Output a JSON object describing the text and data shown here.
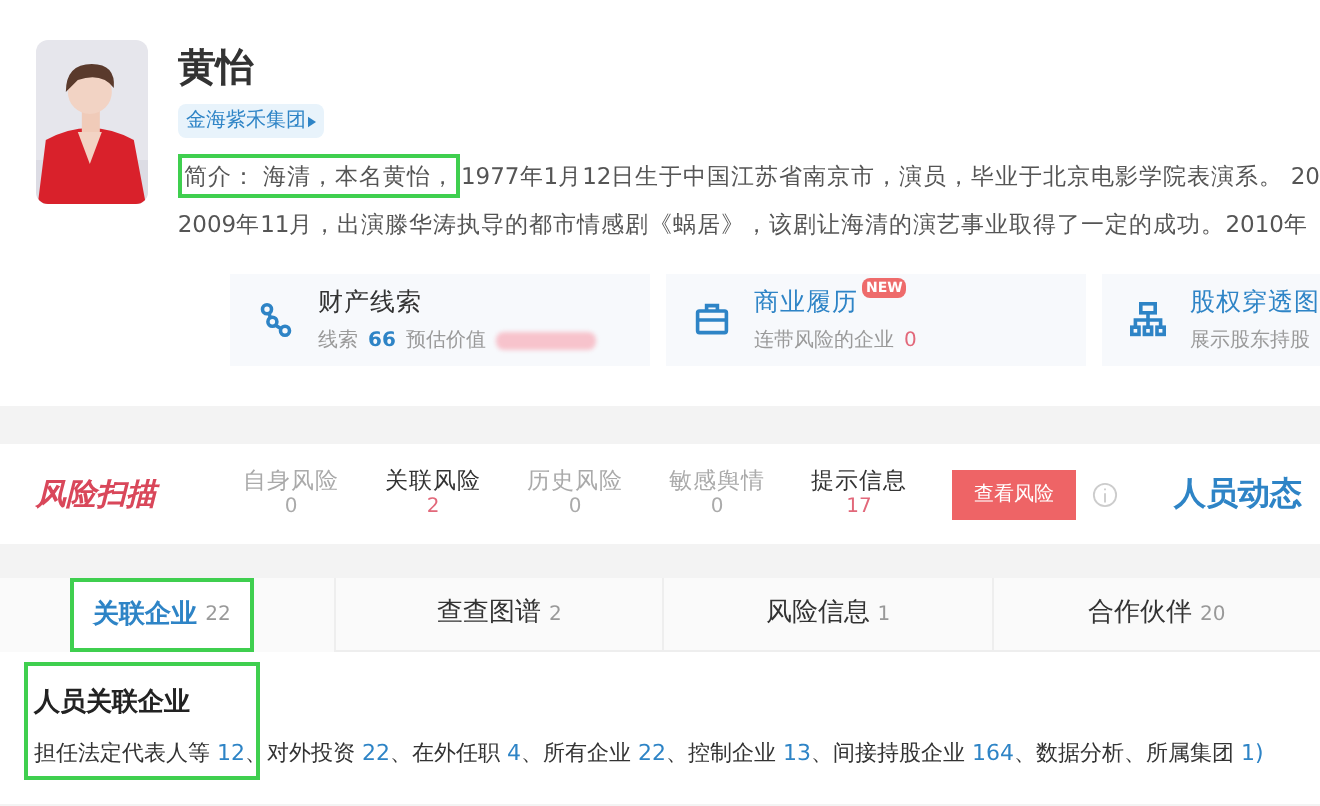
{
  "profile": {
    "kind": "picture",
    "name": "黄怡",
    "group_tag": "金海紫禾集团",
    "intro_highlight": "简介： 海清，本名黄怡，",
    "intro_lines": [
      "1977年1月12日生于中国江苏省南京市，演员，毕业于北京电影学院表演系。 20",
      "2009年11月，出演滕华涛执导的都市情感剧《蜗居》，该剧让海清的演艺事业取得了一定的成功。2010年"
    ]
  },
  "info_cards": [
    {
      "kind": "clue",
      "title": "财产线索",
      "link": false,
      "parts": [
        {
          "kind": "label",
          "text": "线索"
        },
        {
          "kind": "count",
          "text": "66"
        },
        {
          "kind": "label",
          "text": "预估价值"
        },
        {
          "kind": "redacted"
        }
      ]
    },
    {
      "kind": "briefcase",
      "title": "商业履历",
      "link": true,
      "badge": "NEW",
      "parts": [
        {
          "kind": "label",
          "text": "连带风险的企业"
        },
        {
          "kind": "alert",
          "text": "0"
        }
      ]
    },
    {
      "kind": "org",
      "title": "股权穿透图",
      "link": true,
      "parts": [
        {
          "kind": "label",
          "text": "展示股东持股"
        }
      ]
    }
  ],
  "risk_scan": {
    "logo": "风险扫描",
    "items": [
      {
        "label": "自身风险",
        "count": "0",
        "active": false
      },
      {
        "label": "关联风险",
        "count": "2",
        "active": true
      },
      {
        "label": "历史风险",
        "count": "0",
        "active": false
      },
      {
        "label": "敏感舆情",
        "count": "0",
        "active": false
      },
      {
        "label": "提示信息",
        "count": "17",
        "active": true
      }
    ],
    "button": "查看风险",
    "side_title": "人员动态"
  },
  "tabs": [
    {
      "label": "关联企业",
      "count": "22",
      "selected": true,
      "highlighted": true
    },
    {
      "label": "查查图谱",
      "count": "2",
      "selected": false,
      "highlighted": false
    },
    {
      "label": "风险信息",
      "count": "1",
      "selected": false,
      "highlighted": false
    },
    {
      "label": "合作伙伴",
      "count": "20",
      "selected": false,
      "highlighted": false
    }
  ],
  "section": {
    "title": "人员关联企业",
    "highlighted": true,
    "separator": "、",
    "links": [
      {
        "label": "担任法定代表人等",
        "count": "12"
      },
      {
        "label": "对外投资",
        "count": "22"
      },
      {
        "label": "在外任职",
        "count": "4"
      },
      {
        "label": "所有企业",
        "count": "22"
      },
      {
        "label": "控制企业",
        "count": "13"
      },
      {
        "label": "间接持股企业",
        "count": "164"
      },
      {
        "label": "数据分析"
      },
      {
        "label": "所属集团",
        "count": "1"
      }
    ],
    "tail": ")"
  }
}
